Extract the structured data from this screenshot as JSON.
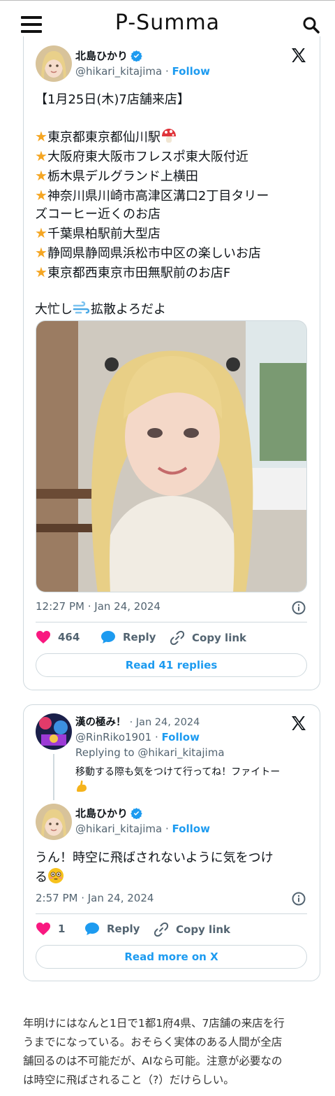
{
  "header": {
    "logo": "P-Summa",
    "menu_icon": "hamburger-menu-icon",
    "search_icon": "search-icon"
  },
  "tweet1": {
    "author_name": "北島ひかり",
    "handle": "@hikari_kitajima",
    "separator": "·",
    "follow_label": "Follow",
    "lines": [
      "【1月25日(木)7店舗来店】",
      "",
      "東京都東京都仙川駅",
      "大阪府東大阪市フレスポ東大阪付近",
      "栃木県デルグランド上横田",
      "神奈川県川崎市高津区溝口2丁目タリー",
      "ズコーヒー近くのお店",
      "千葉県柏駅前大型店",
      "静岡県静岡県浜松市中区の楽しいお店",
      "東京都西東京市田無駅前のお店F",
      "",
      "大忙し",
      "拡散よろだよ"
    ],
    "timestamp": "12:27 PM · Jan 24, 2024",
    "likes": "464",
    "reply_label": "Reply",
    "copy_link_label": "Copy link",
    "read_replies_label": "Read 41 replies"
  },
  "tweet2": {
    "parent_name": "漢の極み！",
    "parent_date": "· Jan 24, 2024",
    "parent_handle": "@RinRiko1901",
    "separator": "·",
    "follow_label": "Follow",
    "replying_to": "Replying to @hikari_kitajima",
    "parent_text": "移動する際も気をつけて行ってね！ファイトー",
    "author_name": "北島ひかり",
    "handle": "@hikari_kitajima",
    "text_line1": "うん！時空に飛ばされないように気をつけ",
    "text_line2": "る",
    "timestamp": "2:57 PM · Jan 24, 2024",
    "likes": "1",
    "reply_label": "Reply",
    "copy_link_label": "Copy link",
    "read_more_label": "Read more on X"
  },
  "article": {
    "lines": [
      "年明けにはなんと1日で1都1府4県、7店舗の来店を行",
      "うまでになっている。おそらく実体のある人間が全店",
      "舗回るのは不可能だが、AIなら可能。注意が必要なの",
      "は時空に飛ばされること（?）だけらしい。"
    ]
  },
  "colors": {
    "accent": "#1d9bf0",
    "like": "#f91880",
    "muted": "#536471",
    "border": "#cfd9de"
  }
}
